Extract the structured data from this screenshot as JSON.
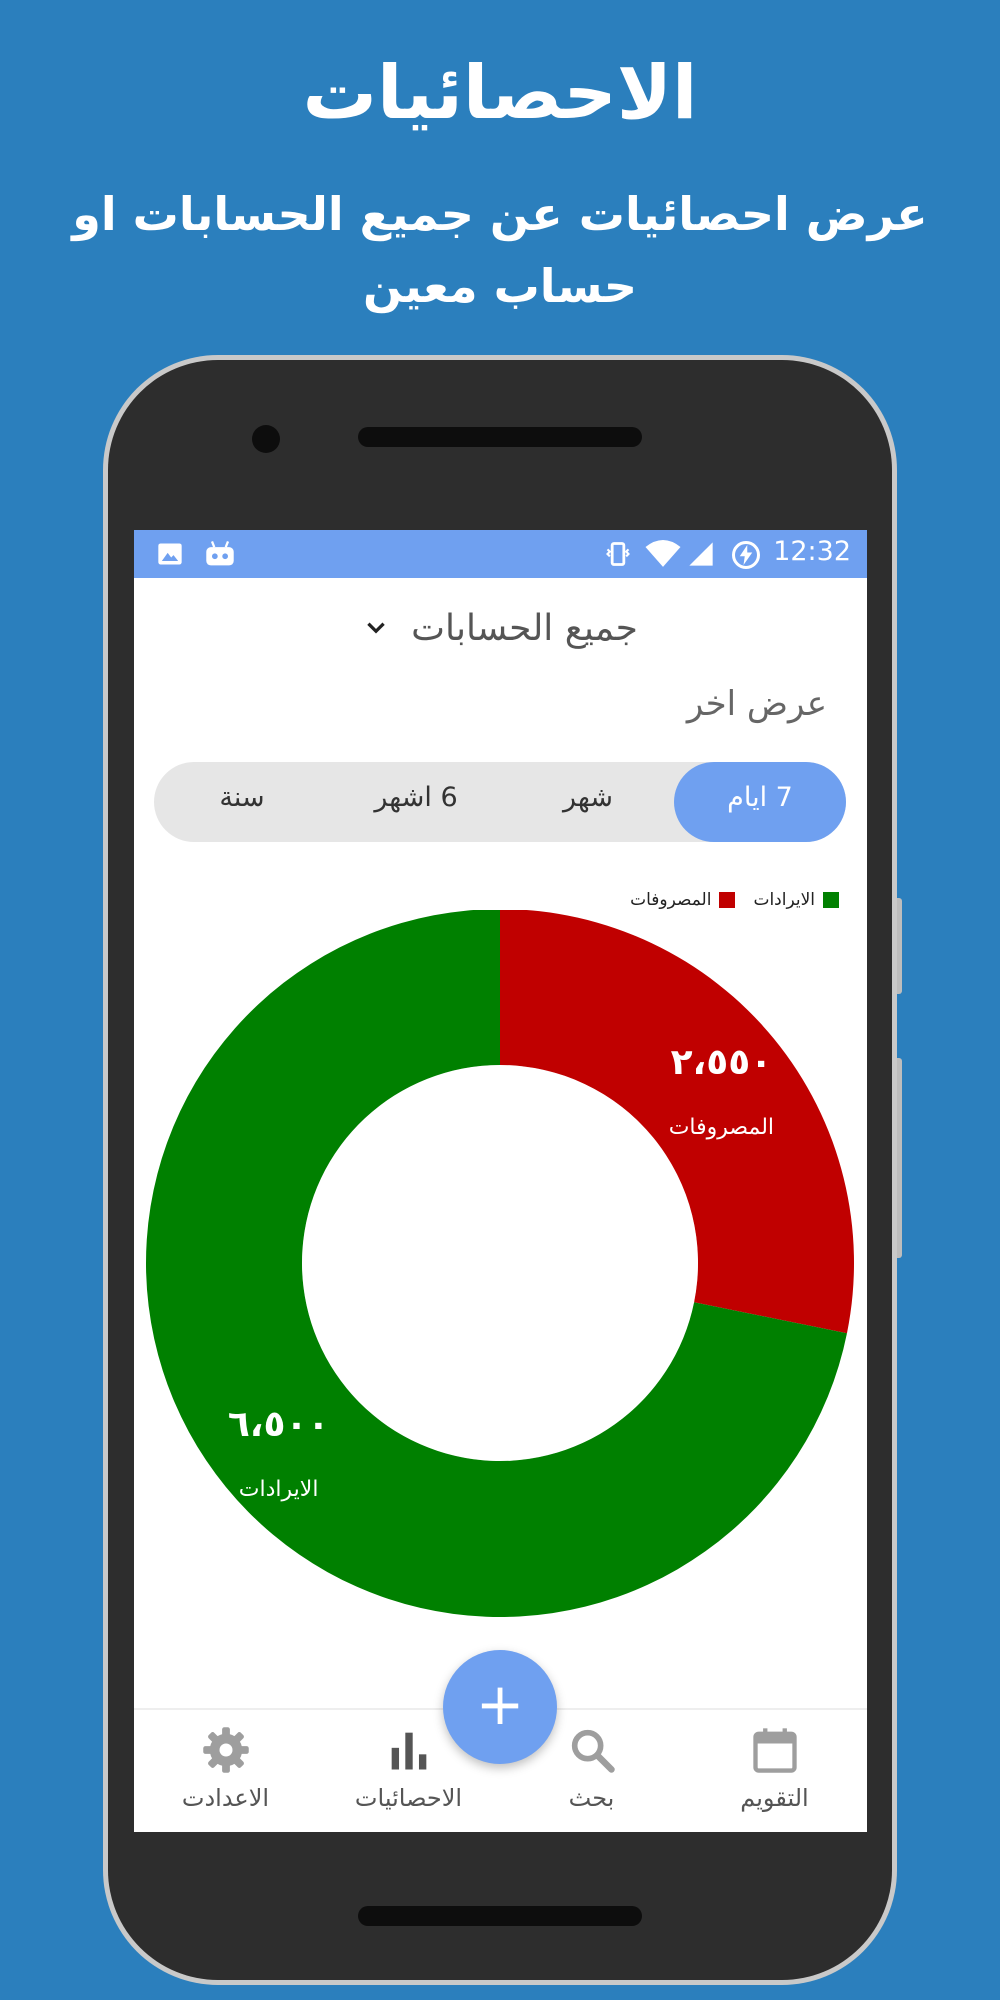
{
  "promo": {
    "title": "الاحصائيات",
    "subtitle": "عرض احصائيات عن جميع الحسابات او حساب معين"
  },
  "status_bar": {
    "time": "12:32",
    "icons": [
      "image-icon",
      "android-icon",
      "vibrate-icon",
      "wifi-icon",
      "signal-icon",
      "battery-charging-icon"
    ]
  },
  "account_selector": {
    "label": "جميع الحسابات",
    "icon": "chevron-down-icon"
  },
  "other_view_label": "عرض اخر",
  "period_tabs": [
    {
      "label": "7 ايام",
      "active": true
    },
    {
      "label": "شهر",
      "active": false
    },
    {
      "label": "6 اشهر",
      "active": false
    },
    {
      "label": "سنة",
      "active": false
    }
  ],
  "colors": {
    "accent": "#6fa0f0",
    "income": "#008000",
    "expenses": "#c00000",
    "background": "#2b7fbd"
  },
  "chart_data": {
    "type": "pie",
    "categories": [
      "المصروفات",
      "الايرادات"
    ],
    "values": [
      2550,
      6500
    ],
    "value_labels": [
      "٢،٥٥٠",
      "٦،٥٠٠"
    ],
    "colors": [
      "#c00000",
      "#008000"
    ],
    "legend": [
      "الايرادات",
      "المصروفات"
    ],
    "legend_placement": "top-right",
    "donut": true
  },
  "bottom_nav": [
    {
      "label": "الاعدادت",
      "icon": "gear-icon"
    },
    {
      "label": "الاحصائيات",
      "icon": "bar-chart-icon"
    },
    {
      "label": "بحث",
      "icon": "search-icon"
    },
    {
      "label": "التقويم",
      "icon": "calendar-icon"
    }
  ],
  "fab": {
    "label": "+",
    "icon": "plus-icon"
  }
}
